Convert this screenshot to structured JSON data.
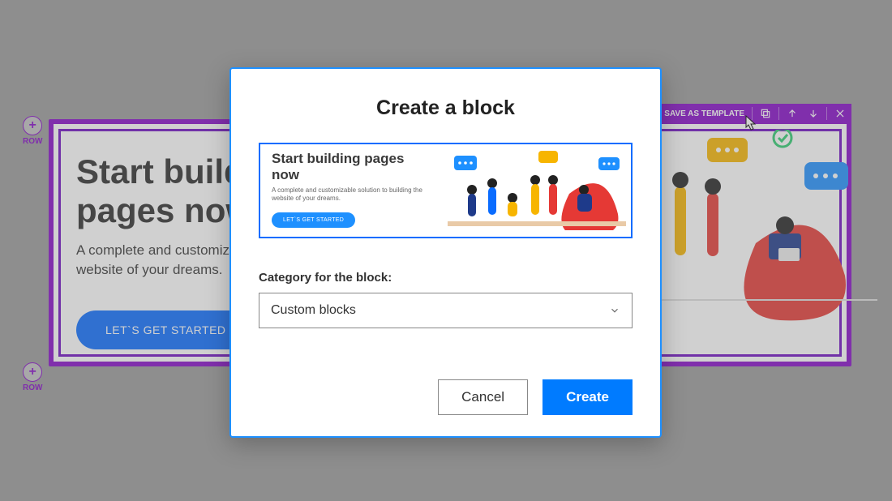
{
  "background": {
    "hero_title_line1": "Start building",
    "hero_title_line2": "pages now",
    "hero_sub_line1": "A complete and customizable solution to building the",
    "hero_sub_line2": "website of your dreams.",
    "hero_button": "LET`S GET STARTED",
    "row_label": "ROW",
    "toolbar": {
      "save_as_template": "SAVE AS TEMPLATE"
    }
  },
  "modal": {
    "title": "Create a block",
    "preview": {
      "title": "Start building pages now",
      "subtitle": "A complete and customizable solution to building the website of your dreams.",
      "button": "LET`S GET STARTED"
    },
    "category_label": "Category for the block:",
    "category_value": "Custom blocks",
    "cancel": "Cancel",
    "create": "Create"
  },
  "colors": {
    "accent_blue": "#007bff",
    "builder_purple": "#8509c8"
  }
}
